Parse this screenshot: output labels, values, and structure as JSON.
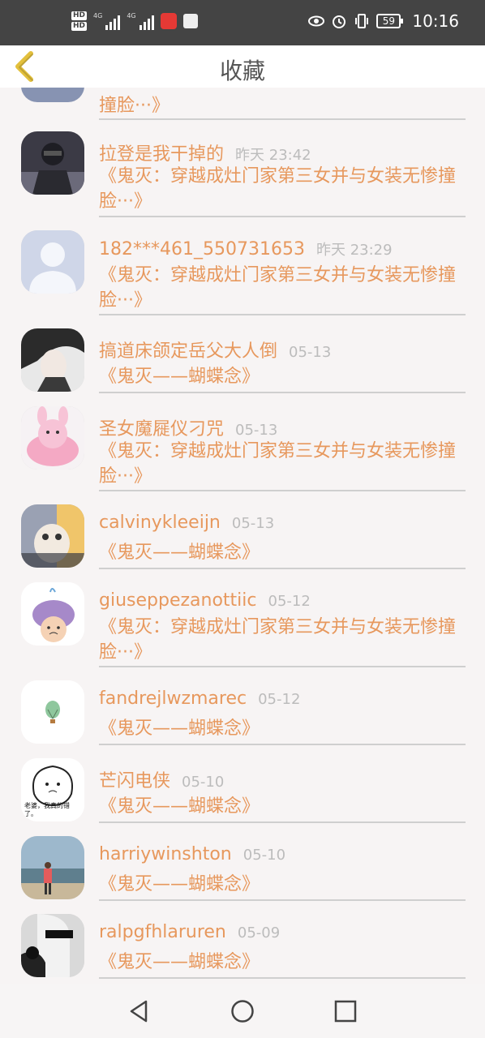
{
  "status_bar": {
    "hd1": "HD",
    "hd2": "HD",
    "net1": "4G",
    "net2": "4G",
    "battery": "59",
    "time": "10:16",
    "icons": [
      "eye-icon",
      "alarm-icon",
      "vibrate-icon"
    ]
  },
  "header": {
    "title": "收藏"
  },
  "partial_item": {
    "book": "撞脸···》"
  },
  "items": [
    {
      "name": "拉登是我干掉的",
      "time": "昨天 23:42",
      "book": "《鬼灭：穿越成灶门家第三女并与女装无惨撞脸···》",
      "avatar": "soldier"
    },
    {
      "name": "182***461_550731653",
      "time": "昨天 23:29",
      "book": "《鬼灭：穿越成灶门家第三女并与女装无惨撞脸···》",
      "avatar": "default"
    },
    {
      "name": "搞道床颌定岳父大人倒",
      "time": "05-13",
      "book": "《鬼灭——蝴蝶念》",
      "avatar": "woman"
    },
    {
      "name": "圣女魔屣仪刁咒",
      "time": "05-13",
      "book": "《鬼灭：穿越成灶门家第三女并与女装无惨撞脸···》",
      "avatar": "pink-chair"
    },
    {
      "name": "calvinykleeijn",
      "time": "05-13",
      "book": "《鬼灭——蝴蝶念》",
      "avatar": "kitten"
    },
    {
      "name": "giuseppezanottiic",
      "time": "05-12",
      "book": "《鬼灭：穿越成灶门家第三女并与女装无惨撞脸···》",
      "avatar": "whale"
    },
    {
      "name": "fandrejlwzmarec",
      "time": "05-12",
      "book": "《鬼灭——蝴蝶念》",
      "avatar": "balloon"
    },
    {
      "name": "芒闪电侠",
      "time": "05-10",
      "book": "《鬼灭——蝴蝶念》",
      "avatar": "cartoon",
      "avatar_caption": "老婆，我真的错了。"
    },
    {
      "name": "harriywinshton",
      "time": "05-10",
      "book": "《鬼灭——蝴蝶念》",
      "avatar": "beach"
    },
    {
      "name": "ralpgfhlaruren",
      "time": "05-09",
      "book": "《鬼灭——蝴蝶念》",
      "avatar": "bw-woman"
    }
  ],
  "nav": {
    "back": "back-triangle-icon",
    "home": "home-circle-icon",
    "recent": "recent-square-icon"
  },
  "colors": {
    "accent": "#e7985d",
    "back_arrow": "#e3c03c",
    "status_bar": "#444444"
  }
}
